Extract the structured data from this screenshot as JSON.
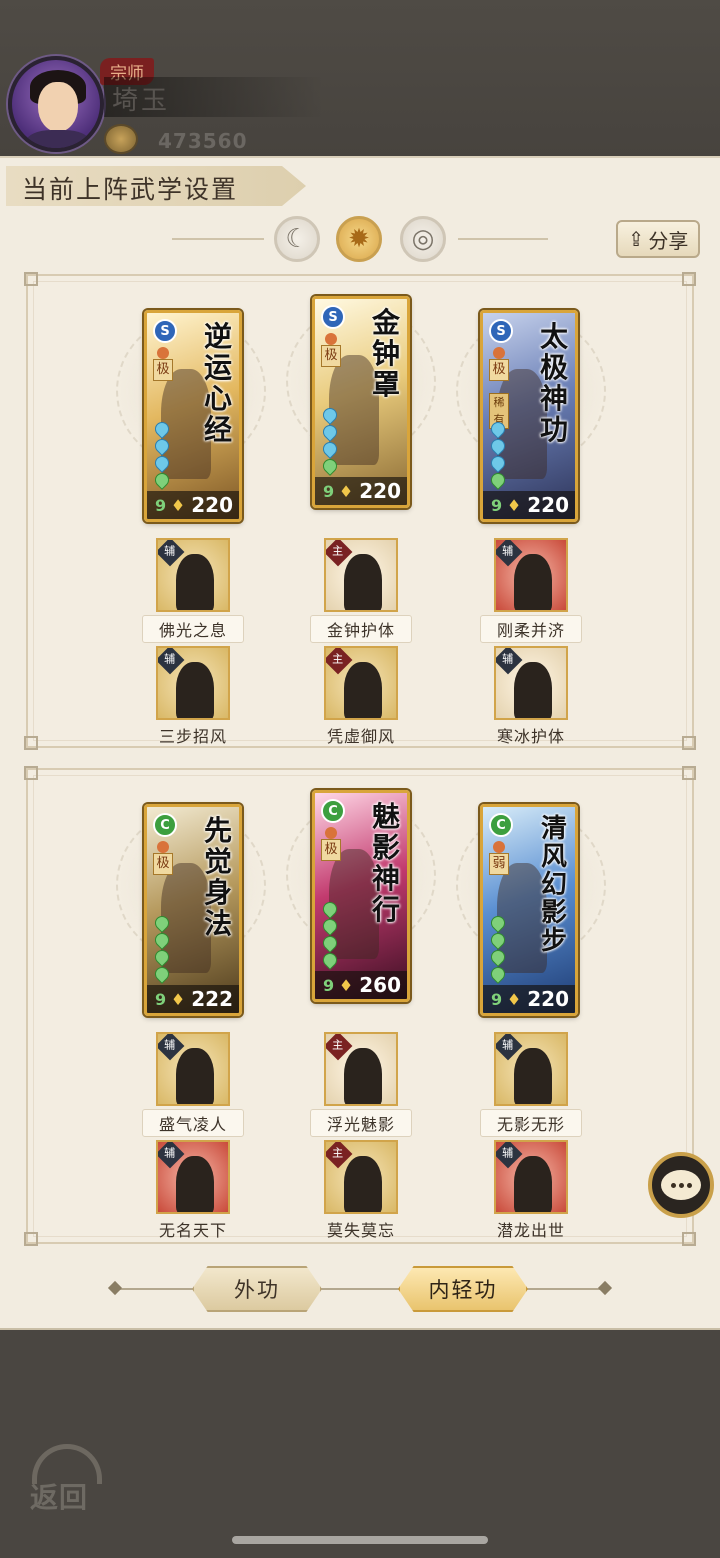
{
  "player": {
    "rank": "宗师",
    "name": "埼玉",
    "currency_value": "473560",
    "avatar_icon": "hero-portrait-icon",
    "currency_icon": "gold-coin-icon"
  },
  "panel": {
    "title": "当前上阵武学设置",
    "share_label": "分享",
    "share_icon": "share-icon",
    "tabs": [
      {
        "icon": "moon-orb-icon",
        "active": false
      },
      {
        "icon": "sun-orb-icon",
        "active": true
      },
      {
        "icon": "ring-orb-icon",
        "active": false
      }
    ]
  },
  "sections": [
    {
      "cards": [
        {
          "name": "逆运心经",
          "type_icon": "S",
          "grade": "极",
          "power": "220",
          "extra": ""
        },
        {
          "name": "金钟罩",
          "type_icon": "S",
          "grade": "极",
          "power": "220",
          "extra": ""
        },
        {
          "name": "太极神功",
          "type_icon": "S",
          "grade": "极",
          "power": "220",
          "extra": "稀有"
        }
      ],
      "skills_row1": [
        {
          "role": "辅",
          "label": "佛光之息"
        },
        {
          "role": "主",
          "label": "金钟护体"
        },
        {
          "role": "辅",
          "label": "刚柔并济"
        }
      ],
      "skills_row2": [
        {
          "role": "辅",
          "label": "三步招风"
        },
        {
          "role": "主",
          "label": "凭虚御风"
        },
        {
          "role": "辅",
          "label": "寒冰护体"
        }
      ]
    },
    {
      "cards": [
        {
          "name": "先觉身法",
          "type_icon": "C",
          "grade": "极",
          "power": "222",
          "extra": ""
        },
        {
          "name": "魅影神行",
          "type_icon": "C",
          "grade": "极",
          "power": "260",
          "extra": ""
        },
        {
          "name": "清风幻影步",
          "type_icon": "C",
          "grade": "弱",
          "power": "220",
          "extra": ""
        }
      ],
      "skills_row1": [
        {
          "role": "辅",
          "label": "盛气凌人"
        },
        {
          "role": "主",
          "label": "浮光魅影"
        },
        {
          "role": "辅",
          "label": "无影无形"
        }
      ],
      "skills_row2": [
        {
          "role": "辅",
          "label": "无名天下"
        },
        {
          "role": "主",
          "label": "莫失莫忘"
        },
        {
          "role": "辅",
          "label": "潜龙出世"
        }
      ]
    }
  ],
  "switches": {
    "outer": "外功",
    "inner": "内轻功",
    "active": "inner"
  },
  "chat_icon": "chat-bubble-icon",
  "back": {
    "label": "返回",
    "icon": "back-arrow-icon"
  },
  "colors": {
    "gold_frame": "#d9a53a",
    "panel_bg": "#f2ece0",
    "main_role": "#7a2222",
    "support_role": "#2c3340"
  }
}
